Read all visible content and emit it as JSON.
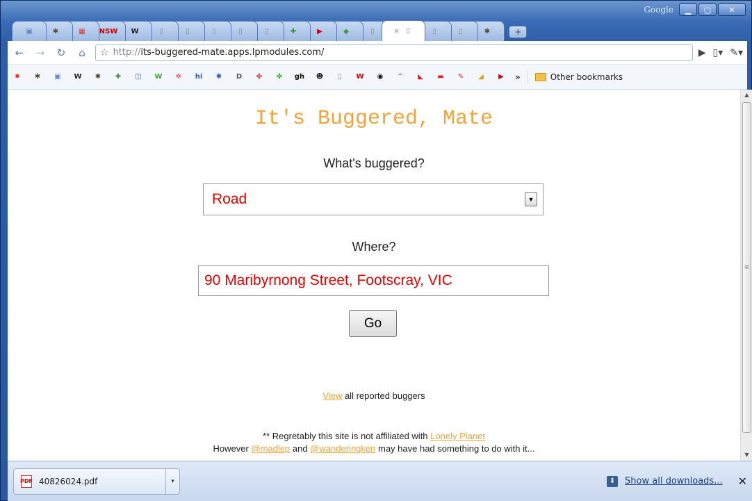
{
  "window": {
    "google_label": "Google",
    "minimize_icon": "minimize-icon",
    "maximize_icon": "maximize-icon",
    "close_icon": "close-icon"
  },
  "tabs": [
    {
      "icon": "calendar-favicon",
      "glyph": "▣",
      "color": "#5a86c8"
    },
    {
      "icon": "bug-favicon",
      "glyph": "✱",
      "color": "#5b4a2e"
    },
    {
      "icon": "red-chinese-favicon",
      "glyph": "▦",
      "color": "#d33"
    },
    {
      "icon": "nsw-favicon",
      "glyph": "NSW",
      "color": "#c00"
    },
    {
      "icon": "wikipedia-favicon",
      "glyph": "W",
      "color": "#222"
    },
    {
      "icon": "page-favicon",
      "glyph": "▯",
      "color": "#888"
    },
    {
      "icon": "page-favicon",
      "glyph": "▯",
      "color": "#888"
    },
    {
      "icon": "page-favicon",
      "glyph": "▯",
      "color": "#888"
    },
    {
      "icon": "page-favicon",
      "glyph": "▯",
      "color": "#888"
    },
    {
      "icon": "page-favicon",
      "glyph": "▯",
      "color": "#888"
    },
    {
      "icon": "google-favicon",
      "glyph": "✚",
      "color": "#3b8e3b"
    },
    {
      "icon": "youtube-favicon",
      "glyph": "▶",
      "color": "#c00"
    },
    {
      "icon": "green-favicon",
      "glyph": "◆",
      "color": "#3a9a3a"
    },
    {
      "icon": "page-favicon",
      "glyph": "▯",
      "color": "#888"
    },
    {
      "icon": "page-favicon",
      "glyph": "▯",
      "color": "#888",
      "active": true
    },
    {
      "icon": "page-favicon",
      "glyph": "▯",
      "color": "#888"
    },
    {
      "icon": "page-favicon",
      "glyph": "▯",
      "color": "#888"
    },
    {
      "icon": "bug-favicon",
      "glyph": "✱",
      "color": "#5b4a2e"
    }
  ],
  "toolbar": {
    "url_scheme": "http://",
    "url_host": "its-buggered-mate.apps.lpmodules.com/"
  },
  "bookmarks": {
    "items": [
      {
        "icon": "red-burst-icon",
        "glyph": "✸",
        "color": "#e33"
      },
      {
        "icon": "bug-icon",
        "glyph": "✱",
        "color": "#5b4a2e"
      },
      {
        "icon": "calendar-icon",
        "glyph": "▣",
        "color": "#5a86c8"
      },
      {
        "icon": "wikipedia-icon",
        "glyph": "W",
        "color": "#222"
      },
      {
        "icon": "bug-icon",
        "glyph": "✱",
        "color": "#5b4a2e"
      },
      {
        "icon": "google-icon",
        "glyph": "✚",
        "color": "#3b8e3b"
      },
      {
        "icon": "reader-icon",
        "glyph": "◫",
        "color": "#3a6bb5"
      },
      {
        "icon": "w-logo-icon",
        "glyph": "W",
        "color": "#4a3"
      },
      {
        "icon": "star-icon",
        "glyph": "✲",
        "color": "#e33"
      },
      {
        "icon": "hi-icon",
        "glyph": "hi",
        "color": "#2e5ea8"
      },
      {
        "icon": "bug-icon",
        "glyph": "✱",
        "color": "#2e5ea8"
      },
      {
        "icon": "page-d-icon",
        "glyph": "D",
        "color": "#555"
      },
      {
        "icon": "colorful-icon",
        "glyph": "✤",
        "color": "#c33"
      },
      {
        "icon": "colorful-icon",
        "glyph": "✤",
        "color": "#2a2"
      },
      {
        "icon": "gh-icon",
        "glyph": "gh",
        "color": "#111"
      },
      {
        "icon": "face-icon",
        "glyph": "☻",
        "color": "#223"
      },
      {
        "icon": "page-icon",
        "glyph": "▯",
        "color": "#888"
      },
      {
        "icon": "w-red-icon",
        "glyph": "W",
        "color": "#c00"
      },
      {
        "icon": "target-icon",
        "glyph": "◉",
        "color": "#111"
      },
      {
        "icon": "wave-icon",
        "glyph": "⌃",
        "color": "#3a6bb5"
      },
      {
        "icon": "qantas-icon",
        "glyph": "◣",
        "color": "#d22"
      },
      {
        "icon": "red-bar-icon",
        "glyph": "▬",
        "color": "#d22"
      },
      {
        "icon": "virgin-icon",
        "glyph": "✎",
        "color": "#d22"
      },
      {
        "icon": "banana-icon",
        "glyph": "◢",
        "color": "#d9a400"
      },
      {
        "icon": "youtube-icon",
        "glyph": "▶",
        "color": "#c00"
      }
    ],
    "more": "»",
    "other": "Other bookmarks"
  },
  "page": {
    "title": "It's Buggered, Mate",
    "question_what": "What's buggered?",
    "selected_option": "Road",
    "question_where": "Where?",
    "where_value": "90 Maribyrnong Street, Footscray, VIC",
    "go_label": "Go",
    "view_link": "View",
    "view_rest": " all reported buggers",
    "foot_line1_pre": "** Regretably this site is not affiliated with ",
    "foot_link_lp": "Lonely Planet",
    "foot_line2_pre": "However ",
    "foot_link_madlep": "@madlep",
    "foot_and": " and ",
    "foot_link_ken": "@wanderingken",
    "foot_line2_post": " may have had something to do with it..."
  },
  "downloads": {
    "file": "40826024.pdf",
    "show_all": "Show all downloads..."
  },
  "colors": {
    "accent_orange": "#f0a43a",
    "input_red": "#e00000"
  }
}
